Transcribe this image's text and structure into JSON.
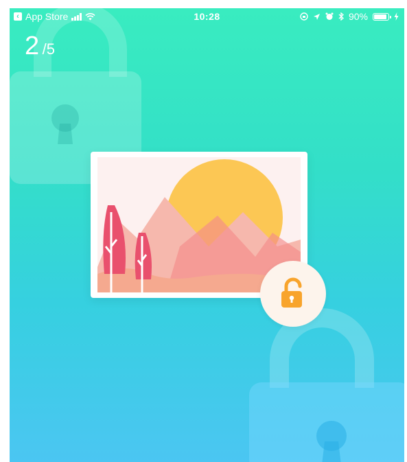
{
  "status_bar": {
    "back_app": "App Store",
    "time": "10:28",
    "battery": "90%",
    "battery_level": 0.9
  },
  "progress": {
    "current": "2",
    "total": "/5"
  },
  "icons": {
    "background_locks": [
      "lock-icon",
      "lock-icon"
    ],
    "badge": "unlock-icon",
    "card": "landscape-image-icon"
  },
  "colors": {
    "gradient_top": "#39ecc0",
    "gradient_bottom": "#4bc6f2",
    "sun": "#fcc754",
    "lock_orange": "#f8a42c"
  }
}
